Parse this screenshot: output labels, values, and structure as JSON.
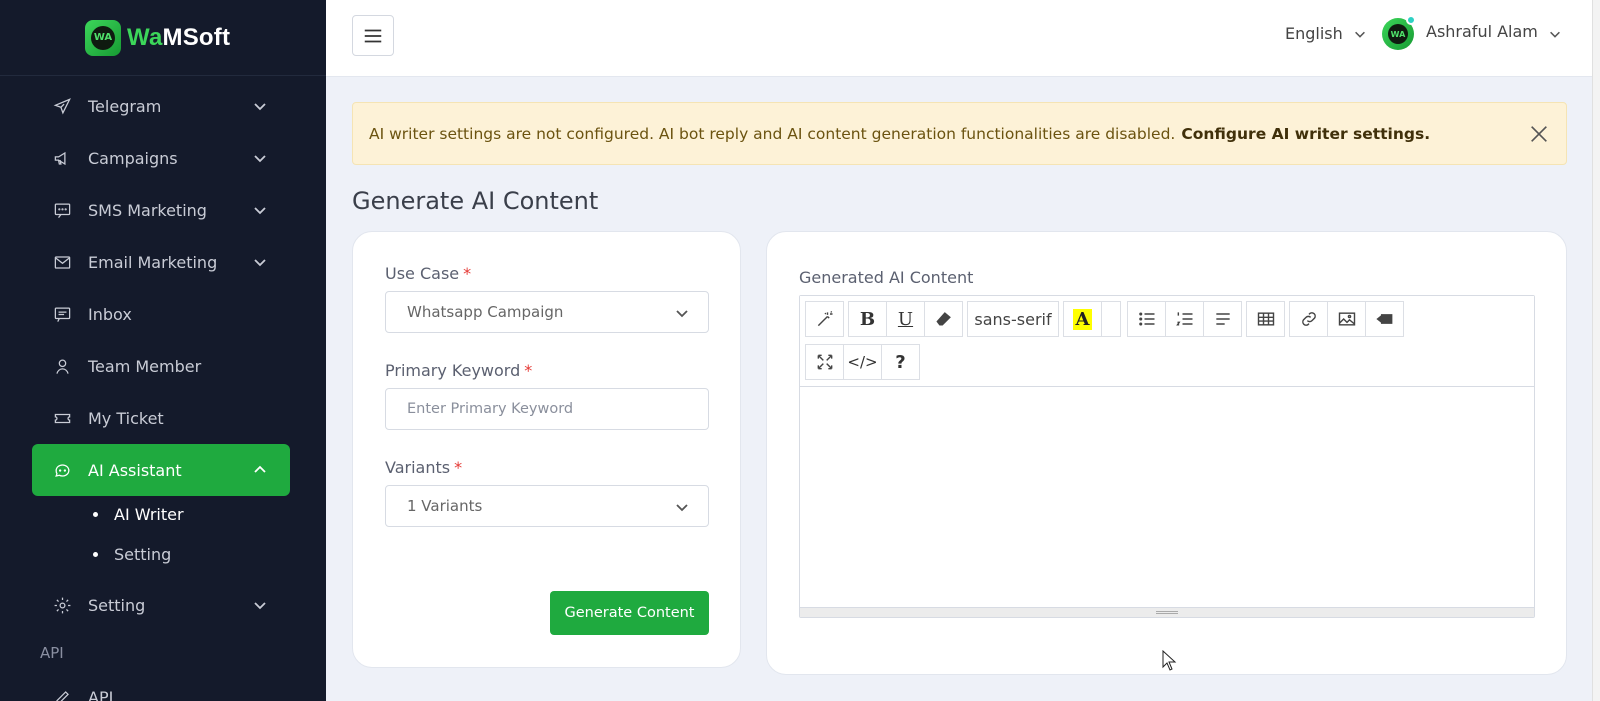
{
  "brand": {
    "prefix": "Wa",
    "suffix": "MSoft",
    "logo_mark": "WA",
    "colors": {
      "accent": "#1faa3f",
      "sidebar_bg": "#141a2b"
    }
  },
  "sidebar": {
    "items": [
      {
        "label": "Telegram",
        "icon": "send-icon",
        "expandable": true
      },
      {
        "label": "Campaigns",
        "icon": "megaphone-icon",
        "expandable": true
      },
      {
        "label": "SMS Marketing",
        "icon": "sms-icon",
        "expandable": true
      },
      {
        "label": "Email Marketing",
        "icon": "mail-icon",
        "expandable": true
      },
      {
        "label": "Inbox",
        "icon": "inbox-icon",
        "expandable": false
      },
      {
        "label": "Team Member",
        "icon": "user-icon",
        "expandable": false
      },
      {
        "label": "My Ticket",
        "icon": "ticket-icon",
        "expandable": false
      },
      {
        "label": "AI Assistant",
        "icon": "chat-bot-icon",
        "expandable": true,
        "active": true
      },
      {
        "label": "Setting",
        "icon": "gear-icon",
        "expandable": true
      },
      {
        "label": "API",
        "icon": "pen-icon",
        "expandable": false
      }
    ],
    "subitems": [
      {
        "label": "AI Writer",
        "current": true
      },
      {
        "label": "Setting",
        "current": false
      }
    ],
    "section_api": "API"
  },
  "header": {
    "language": "English",
    "user_name": "Ashraful Alam",
    "avatar_mark": "WA"
  },
  "alert": {
    "message": "AI writer settings are not configured. AI bot reply and AI content generation functionalities are disabled.",
    "link": "Configure AI writer settings."
  },
  "page_title": "Generate AI Content",
  "form": {
    "use_case_label": "Use Case",
    "use_case_value": "Whatsapp Campaign",
    "keyword_label": "Primary Keyword",
    "keyword_placeholder": "Enter Primary Keyword",
    "variants_label": "Variants",
    "variants_value": "1 Variants",
    "required_mark": "*",
    "submit_label": "Generate Content"
  },
  "editor": {
    "label": "Generated AI Content",
    "font_name": "sans-serif",
    "highlight_glyph": "A",
    "code_glyph": "</>",
    "help_glyph": "?"
  }
}
